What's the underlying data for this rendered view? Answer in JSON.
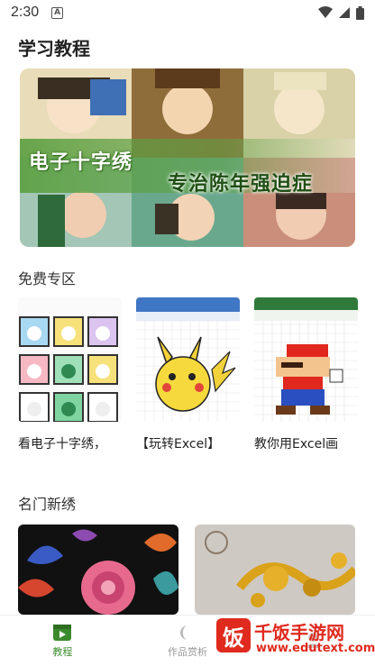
{
  "status": {
    "time": "2:30",
    "app_badge": "A"
  },
  "page": {
    "title": "学习教程"
  },
  "banner": {
    "line1": "电子十字绣",
    "line2": "专治陈年强迫症"
  },
  "free_section": {
    "title": "免费专区",
    "cards": [
      {
        "caption": "看电子十字绣，"
      },
      {
        "caption": "【玩转Excel】"
      },
      {
        "caption": "教你用Excel画"
      }
    ]
  },
  "famous_section": {
    "title": "名门新绣"
  },
  "tabs": [
    {
      "label": "教程",
      "icon": "play-icon",
      "active": true
    },
    {
      "label": "作品赏析",
      "icon": "gallery-icon",
      "active": false
    },
    {
      "label": "",
      "icon": "profile-icon",
      "active": false
    }
  ],
  "watermark": {
    "brand": "千饭手游网",
    "url": "www.edutext.com"
  },
  "colors": {
    "accent": "#3c8a2e",
    "banner_green": "#5ca042"
  }
}
